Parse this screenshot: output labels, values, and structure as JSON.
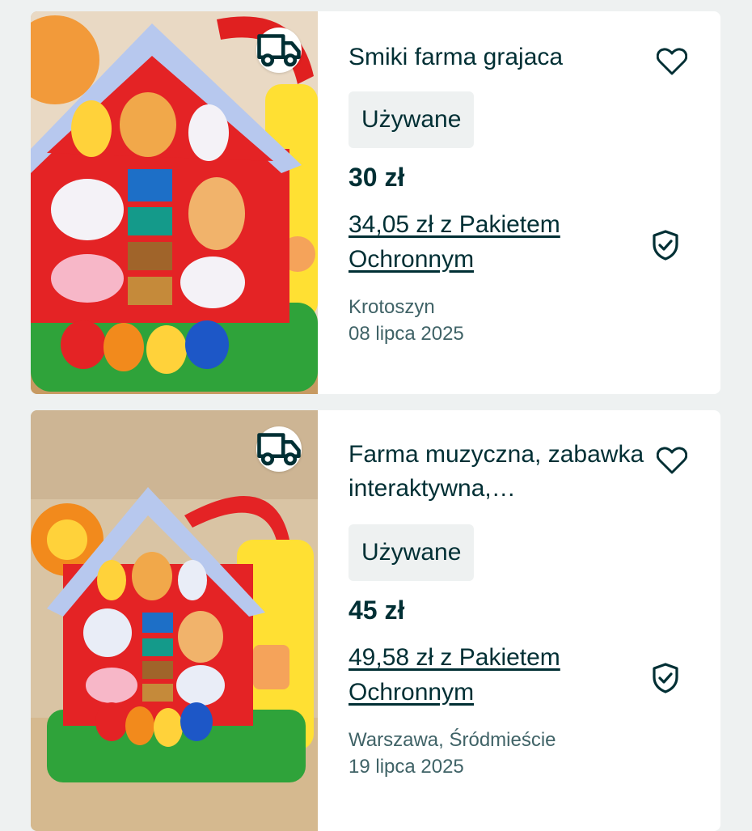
{
  "listings": [
    {
      "title": "Smiki farma grajaca",
      "condition": "Używane",
      "price": "30 zł",
      "protection_price": "34,05 zł z Pakietem Ochronnym",
      "location": "Krotoszyn",
      "date": "08 lipca 2025",
      "delivery_icon": "truck-icon",
      "favorite_icon": "heart-icon",
      "protection_icon": "shield-check-icon"
    },
    {
      "title": "Farma muzyczna, zabawka interaktywna,…",
      "condition": "Używane",
      "price": "45 zł",
      "protection_price": "49,58 zł z Pakietem Ochronnym",
      "location": "Warszawa, Śródmieście",
      "date": "19 lipca 2025",
      "delivery_icon": "truck-icon",
      "favorite_icon": "heart-icon",
      "protection_icon": "shield-check-icon"
    }
  ],
  "colors": {
    "text": "#002f34",
    "muted": "#406367",
    "page_bg": "#eef1f1",
    "card_bg": "#ffffff"
  }
}
